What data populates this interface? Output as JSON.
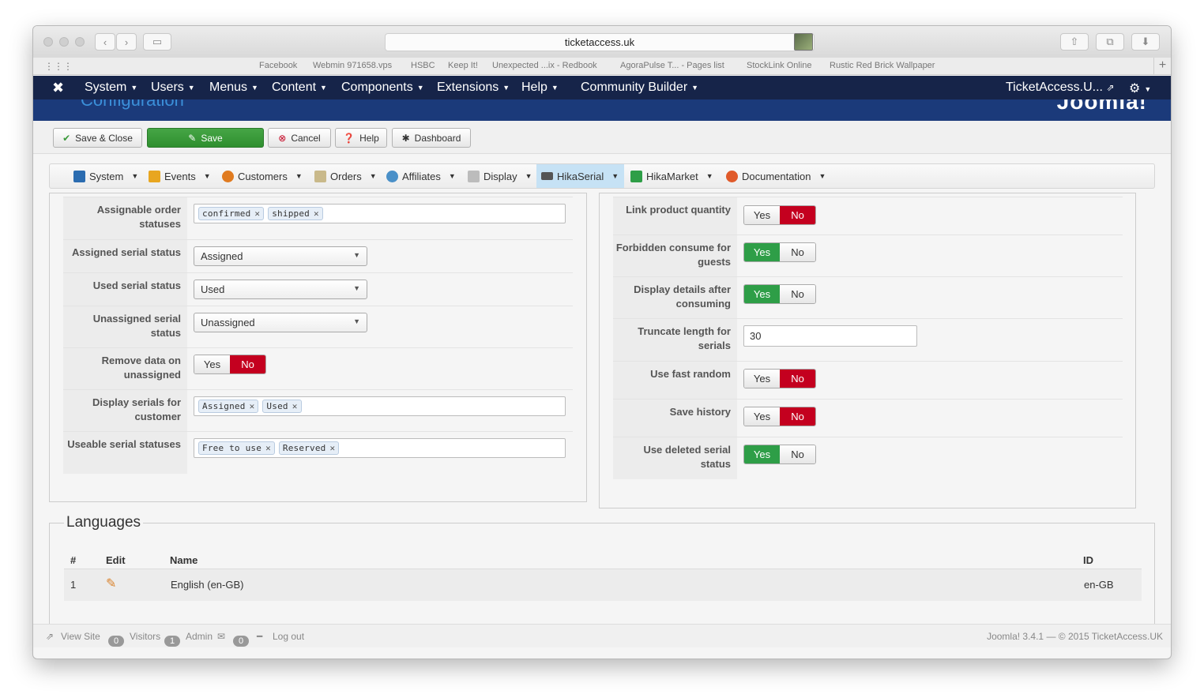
{
  "browser": {
    "url": "ticketaccess.uk",
    "bookmarks": [
      "Facebook",
      "Webmin 971658.vps",
      "HSBC",
      "Keep It!",
      "Unexpected ...ix - Redbook",
      "AgoraPulse T... - Pages list",
      "StockLink Online",
      "Rustic Red Brick Wallpaper"
    ]
  },
  "nav": {
    "items": [
      "System",
      "Users",
      "Menus",
      "Content",
      "Components",
      "Extensions",
      "Help",
      "Community Builder"
    ],
    "site": "TicketAccess.U..."
  },
  "header": {
    "title": "Configuration",
    "logo": "Joomla!"
  },
  "toolbar": {
    "save_close": "Save & Close",
    "save": "Save",
    "cancel": "Cancel",
    "help": "Help",
    "dashboard": "Dashboard"
  },
  "submenu": [
    "System",
    "Events",
    "Customers",
    "Orders",
    "Affiliates",
    "Display",
    "HikaSerial",
    "HikaMarket",
    "Documentation"
  ],
  "left": {
    "assignable_label": "Assignable order statuses",
    "assignable_tags": [
      "confirmed",
      "shipped"
    ],
    "assigned_label": "Assigned serial status",
    "assigned_value": "Assigned",
    "used_label": "Used serial status",
    "used_value": "Used",
    "unassigned_label": "Unassigned serial status",
    "unassigned_value": "Unassigned",
    "remove_label": "Remove data on unassigned",
    "display_label": "Display serials for customer",
    "display_tags": [
      "Assigned",
      "Used"
    ],
    "useable_label": "Useable serial statuses",
    "useable_tags": [
      "Free to use",
      "Reserved"
    ]
  },
  "right": {
    "link_qty_label": "Link product quantity",
    "forbidden_label": "Forbidden consume for guests",
    "display_details_label": "Display details after consuming",
    "truncate_label": "Truncate length for serials",
    "truncate_value": "30",
    "fast_random_label": "Use fast random",
    "save_history_label": "Save history",
    "deleted_label": "Use deleted serial status"
  },
  "toggle": {
    "yes": "Yes",
    "no": "No"
  },
  "languages": {
    "title": "Languages",
    "headers": {
      "num": "#",
      "edit": "Edit",
      "name": "Name",
      "id": "ID"
    },
    "rows": [
      {
        "num": "1",
        "name": "English (en-GB)",
        "id": "en-GB"
      }
    ]
  },
  "status": {
    "view_site": "View Site",
    "visitors_count": "0",
    "visitors": "Visitors",
    "admin_count": "1",
    "admin": "Admin",
    "messages_count": "0",
    "logout": "Log out",
    "version": "Joomla! 3.4.1  —  © 2015 TicketAccess.UK"
  }
}
